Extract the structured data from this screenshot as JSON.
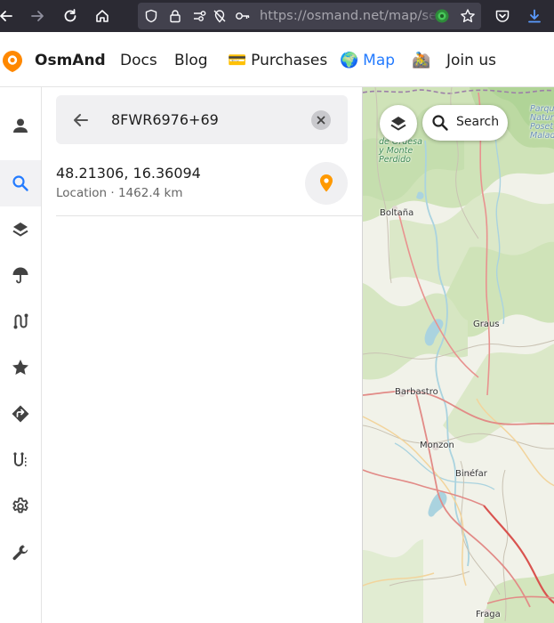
{
  "browser": {
    "url": "https://osmand.net/map/sea",
    "icons": [
      "back-arrow-icon",
      "forward-arrow-icon",
      "reload-icon",
      "home-icon",
      "shield-icon",
      "lock-icon",
      "permissions-icon",
      "location-off-icon",
      "key-icon",
      "extension-icon",
      "bookmark-star-icon",
      "pocket-icon",
      "download-icon"
    ]
  },
  "header": {
    "brand": "OsmAnd",
    "nav": [
      {
        "label": "Docs",
        "emoji": ""
      },
      {
        "label": "Blog",
        "emoji": ""
      },
      {
        "label": "Purchases",
        "emoji": "💳"
      },
      {
        "label": "Map",
        "emoji": "🌍",
        "active": true
      },
      {
        "label": "",
        "emoji": "🚵"
      },
      {
        "label": "Join us",
        "emoji": ""
      }
    ],
    "accent_color": "#237bff",
    "brand_color": "#ff8800"
  },
  "sidebar": {
    "items": [
      {
        "name": "account",
        "icon": "person-icon"
      },
      {
        "name": "search",
        "icon": "search-icon",
        "selected": true
      },
      {
        "name": "configure-map",
        "icon": "layers-icon"
      },
      {
        "name": "weather",
        "icon": "umbrella-icon"
      },
      {
        "name": "tracks",
        "icon": "route-icon"
      },
      {
        "name": "favorites",
        "icon": "star-icon"
      },
      {
        "name": "navigation",
        "icon": "directions-icon"
      },
      {
        "name": "travel",
        "icon": "travel-icon"
      },
      {
        "name": "settings",
        "icon": "gear-icon"
      },
      {
        "name": "tools",
        "icon": "wrench-icon"
      }
    ]
  },
  "search": {
    "query": "8FWR6976+69"
  },
  "results": [
    {
      "title": "48.21306, 16.36094",
      "subtitle": "Location · 1462.4 km",
      "icon": "location-pin-icon"
    }
  ],
  "map": {
    "search_label": "Search",
    "labels": {
      "ordesa": "de Ordesa\ny Monte\nPerdido",
      "parque": "Parque\nNatura\nPoset\nMalade",
      "boltana": "Boltaña",
      "graus": "Graus",
      "barbastro": "Barbastro",
      "monzon": "Monzon",
      "binefar": "Binéfar",
      "fraga": "Fraga"
    }
  }
}
